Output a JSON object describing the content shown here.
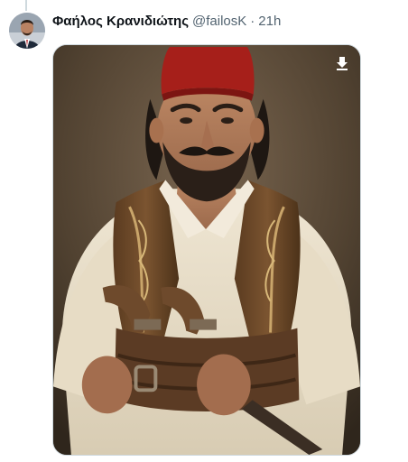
{
  "tweet": {
    "author": {
      "display_name": "Φαήλος Κρανιδιώτης",
      "handle": "@failosK",
      "avatar_icon": "user-avatar-photo"
    },
    "separator": "·",
    "time": "21h",
    "media": {
      "type": "image",
      "subject": "portrait photo",
      "icon": "download-icon"
    }
  },
  "colors": {
    "text_primary": "#0f1419",
    "text_secondary": "#536471",
    "border": "#cfd9de"
  }
}
